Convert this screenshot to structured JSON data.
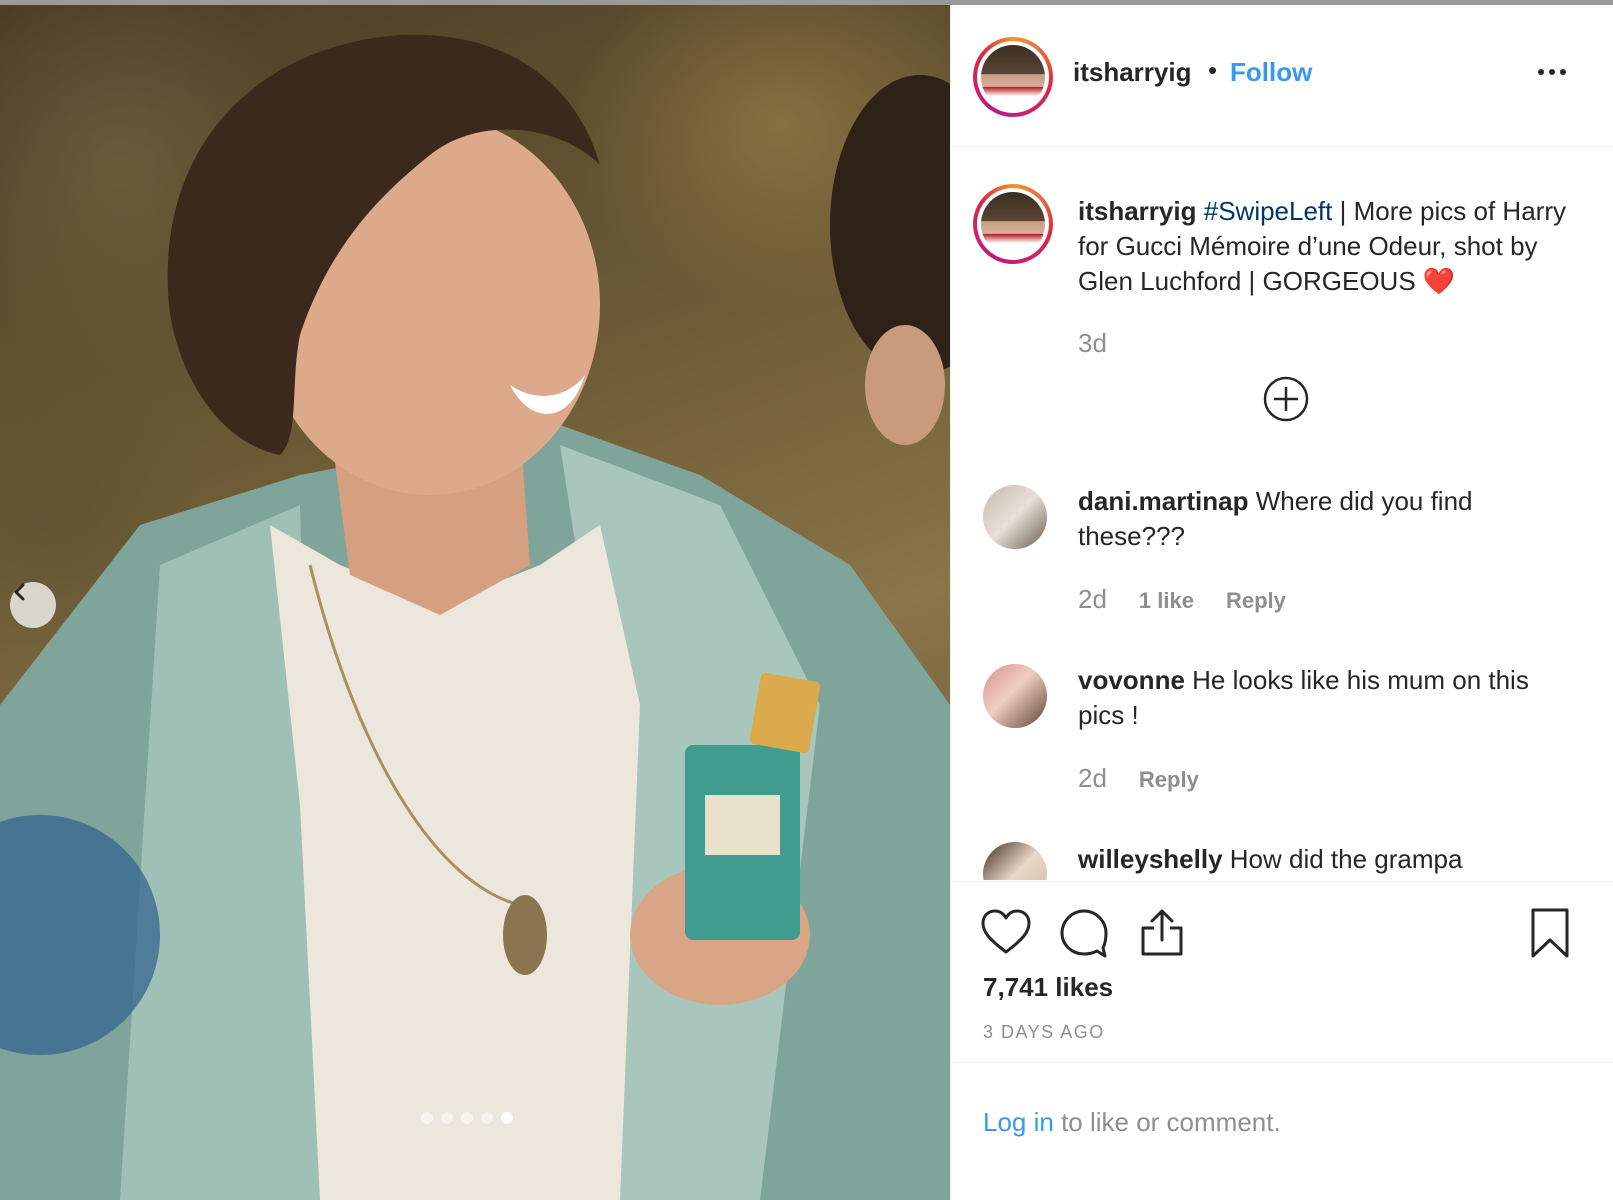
{
  "post": {
    "author": "itsharryig",
    "separator": "•",
    "follow_label": "Follow",
    "photo_dots_total": 5,
    "photo_dots_active": 5
  },
  "caption": {
    "username": "itsharryig",
    "hashtag": "#SwipeLeft",
    "text": " | More pics of Harry for Gucci Mémoire d’une Odeur, shot by Glen Luchford | GORGEOUS ❤️",
    "time": "3d"
  },
  "comments": [
    {
      "username": "dani.martinap",
      "text": "Where did you find these???",
      "time": "2d",
      "likes": "1 like",
      "reply": "Reply"
    },
    {
      "username": "vovonne",
      "text": "He looks like his mum on this pics !",
      "time": "2d",
      "likes": "",
      "reply": "Reply"
    },
    {
      "username": "willeyshelly",
      "text": "How did the grampa",
      "time": "",
      "likes": "",
      "reply": ""
    }
  ],
  "stats": {
    "likes": "7,741 likes",
    "posted": "3 DAYS AGO"
  },
  "login": {
    "link": "Log in",
    "rest": " to like or comment."
  },
  "icons": {
    "prev": "chevron-left-icon",
    "more": "more-options-icon",
    "load_more": "plus-circle-icon",
    "like": "heart-icon",
    "comment": "comment-icon",
    "share": "share-icon",
    "save": "bookmark-icon"
  }
}
